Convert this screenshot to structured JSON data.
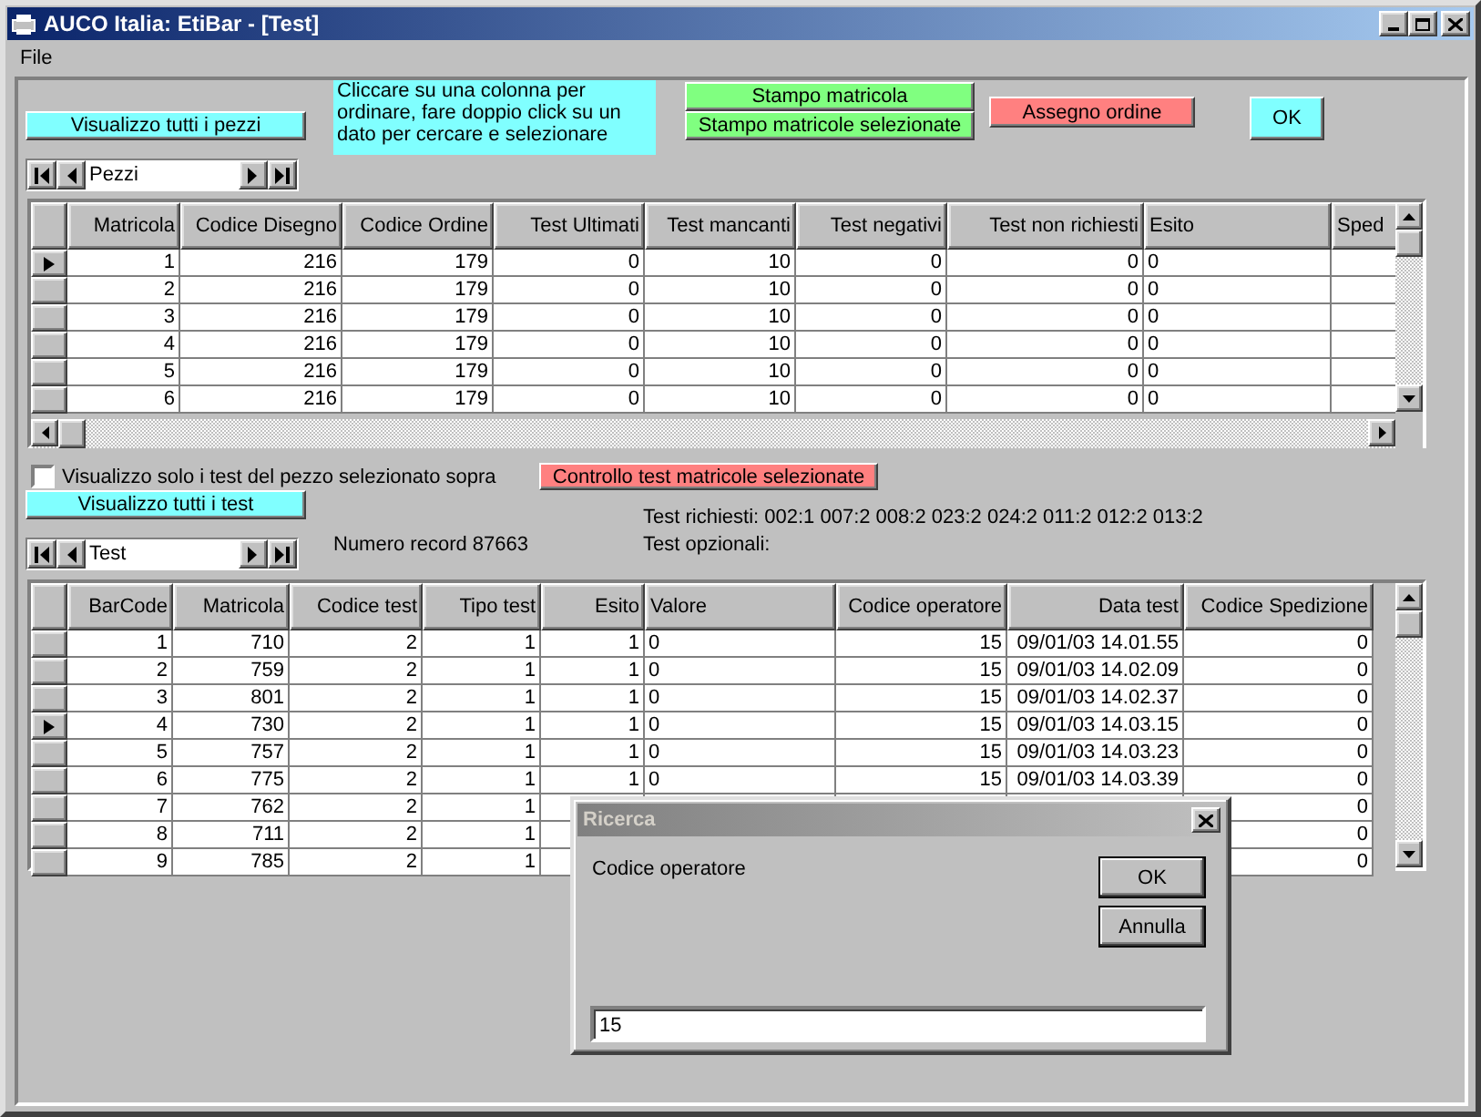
{
  "window": {
    "title": "AUCO Italia: EtiBar - [Test]"
  },
  "menu": [
    "File"
  ],
  "toolbar": {
    "show_all_pieces": "Visualizzo tutti i pezzi",
    "hint": "Cliccare su una colonna per ordinare, fare doppio click su un dato per cercare e selezionare",
    "print_buttons": [
      "Stampo matricola",
      "Stampo matricole selezionate"
    ],
    "assign_button": "Assegno ordine",
    "ok_button": "OK"
  },
  "pieces_navigator": {
    "value": "Pezzi"
  },
  "pieces_grid": {
    "columns": [
      "Matricola",
      "Codice Disegno",
      "Codice Ordine",
      "Test Ultimati",
      "Test mancanti",
      "Test negativi",
      "Test non richiesti",
      "Esito",
      "Sped"
    ],
    "rows": [
      {
        "selected": true,
        "cells": [
          "1",
          "216",
          "179",
          "0",
          "10",
          "0",
          "0",
          "0"
        ]
      },
      {
        "selected": false,
        "cells": [
          "2",
          "216",
          "179",
          "0",
          "10",
          "0",
          "0",
          "0"
        ]
      },
      {
        "selected": false,
        "cells": [
          "3",
          "216",
          "179",
          "0",
          "10",
          "0",
          "0",
          "0"
        ]
      },
      {
        "selected": false,
        "cells": [
          "4",
          "216",
          "179",
          "0",
          "10",
          "0",
          "0",
          "0"
        ]
      },
      {
        "selected": false,
        "cells": [
          "5",
          "216",
          "179",
          "0",
          "10",
          "0",
          "0",
          "0"
        ]
      },
      {
        "selected": false,
        "cells": [
          "6",
          "216",
          "179",
          "0",
          "10",
          "0",
          "0",
          "0"
        ]
      }
    ]
  },
  "filter_checkbox": {
    "label": "Visualizzo solo i test del pezzo selezionato sopra",
    "checked": false
  },
  "check_button": "Controllo test matricole selezionate",
  "show_all_tests": "Visualizzo tutti i test",
  "tests_navigator": {
    "value": "Test"
  },
  "record_count": "Numero record 87663",
  "required_tests": "Test richiesti: 002:1 007:2 008:2 023:2 024:2 011:2 012:2 013:2",
  "optional_tests": "Test opzionali:",
  "tests_grid": {
    "columns": [
      "BarCode",
      "Matricola",
      "Codice test",
      "Tipo test",
      "Esito",
      "Valore",
      "Codice operatore",
      "Data test",
      "Codice Spedizione"
    ],
    "rows": [
      {
        "selected": false,
        "cells": [
          "1",
          "710",
          "2",
          "1",
          "1",
          "0",
          "15",
          "09/01/03 14.01.55",
          "0"
        ]
      },
      {
        "selected": false,
        "cells": [
          "2",
          "759",
          "2",
          "1",
          "1",
          "0",
          "15",
          "09/01/03 14.02.09",
          "0"
        ]
      },
      {
        "selected": false,
        "cells": [
          "3",
          "801",
          "2",
          "1",
          "1",
          "0",
          "15",
          "09/01/03 14.02.37",
          "0"
        ]
      },
      {
        "selected": true,
        "cells": [
          "4",
          "730",
          "2",
          "1",
          "1",
          "0",
          "15",
          "09/01/03 14.03.15",
          "0"
        ]
      },
      {
        "selected": false,
        "cells": [
          "5",
          "757",
          "2",
          "1",
          "1",
          "0",
          "15",
          "09/01/03 14.03.23",
          "0"
        ]
      },
      {
        "selected": false,
        "cells": [
          "6",
          "775",
          "2",
          "1",
          "1",
          "0",
          "15",
          "09/01/03 14.03.39",
          "0"
        ]
      },
      {
        "selected": false,
        "cells": [
          "7",
          "762",
          "2",
          "1",
          null,
          null,
          null,
          null,
          "0"
        ]
      },
      {
        "selected": false,
        "cells": [
          "8",
          "711",
          "2",
          "1",
          null,
          null,
          null,
          null,
          "0"
        ]
      },
      {
        "selected": false,
        "cells": [
          "9",
          "785",
          "2",
          "1",
          null,
          null,
          null,
          null,
          "0"
        ]
      }
    ]
  },
  "dialog": {
    "title": "Ricerca",
    "active": false,
    "prompt": "Codice operatore",
    "buttons": [
      "OK",
      "Annulla"
    ],
    "value": "15"
  }
}
